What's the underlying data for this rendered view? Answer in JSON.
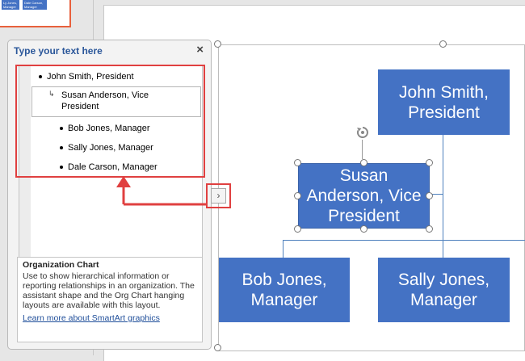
{
  "thumbnail": {
    "box1_label": "Ly Jones, Manager",
    "box2_label": "Dale Carson, Manager"
  },
  "text_pane": {
    "title": "Type your text here",
    "close_label": "×",
    "items": [
      {
        "label": "John Smith, President",
        "level": 1
      },
      {
        "label": "Susan Anderson, Vice President",
        "level": 2
      },
      {
        "label": "Bob Jones, Manager",
        "level": 1
      },
      {
        "label": "Sally Jones, Manager",
        "level": 1
      },
      {
        "label": "Dale Carson, Manager",
        "level": 1
      }
    ],
    "description": {
      "heading": "Organization Chart",
      "body": "Use to show hierarchical information or reporting relationships in an organization. The assistant shape and the Org Chart hanging layouts are available with this layout.",
      "link": "Learn more about SmartArt graphics"
    }
  },
  "expand_button": {
    "label": "›"
  },
  "org_chart": {
    "president": "John Smith, President",
    "vice_president": "Susan Anderson, Vice President",
    "manager1": "Bob Jones, Manager",
    "manager2": "Sally Jones, Manager"
  },
  "colors": {
    "box_fill": "#4472c4",
    "annotation_red": "#e04040",
    "pane_title": "#2b579a"
  }
}
